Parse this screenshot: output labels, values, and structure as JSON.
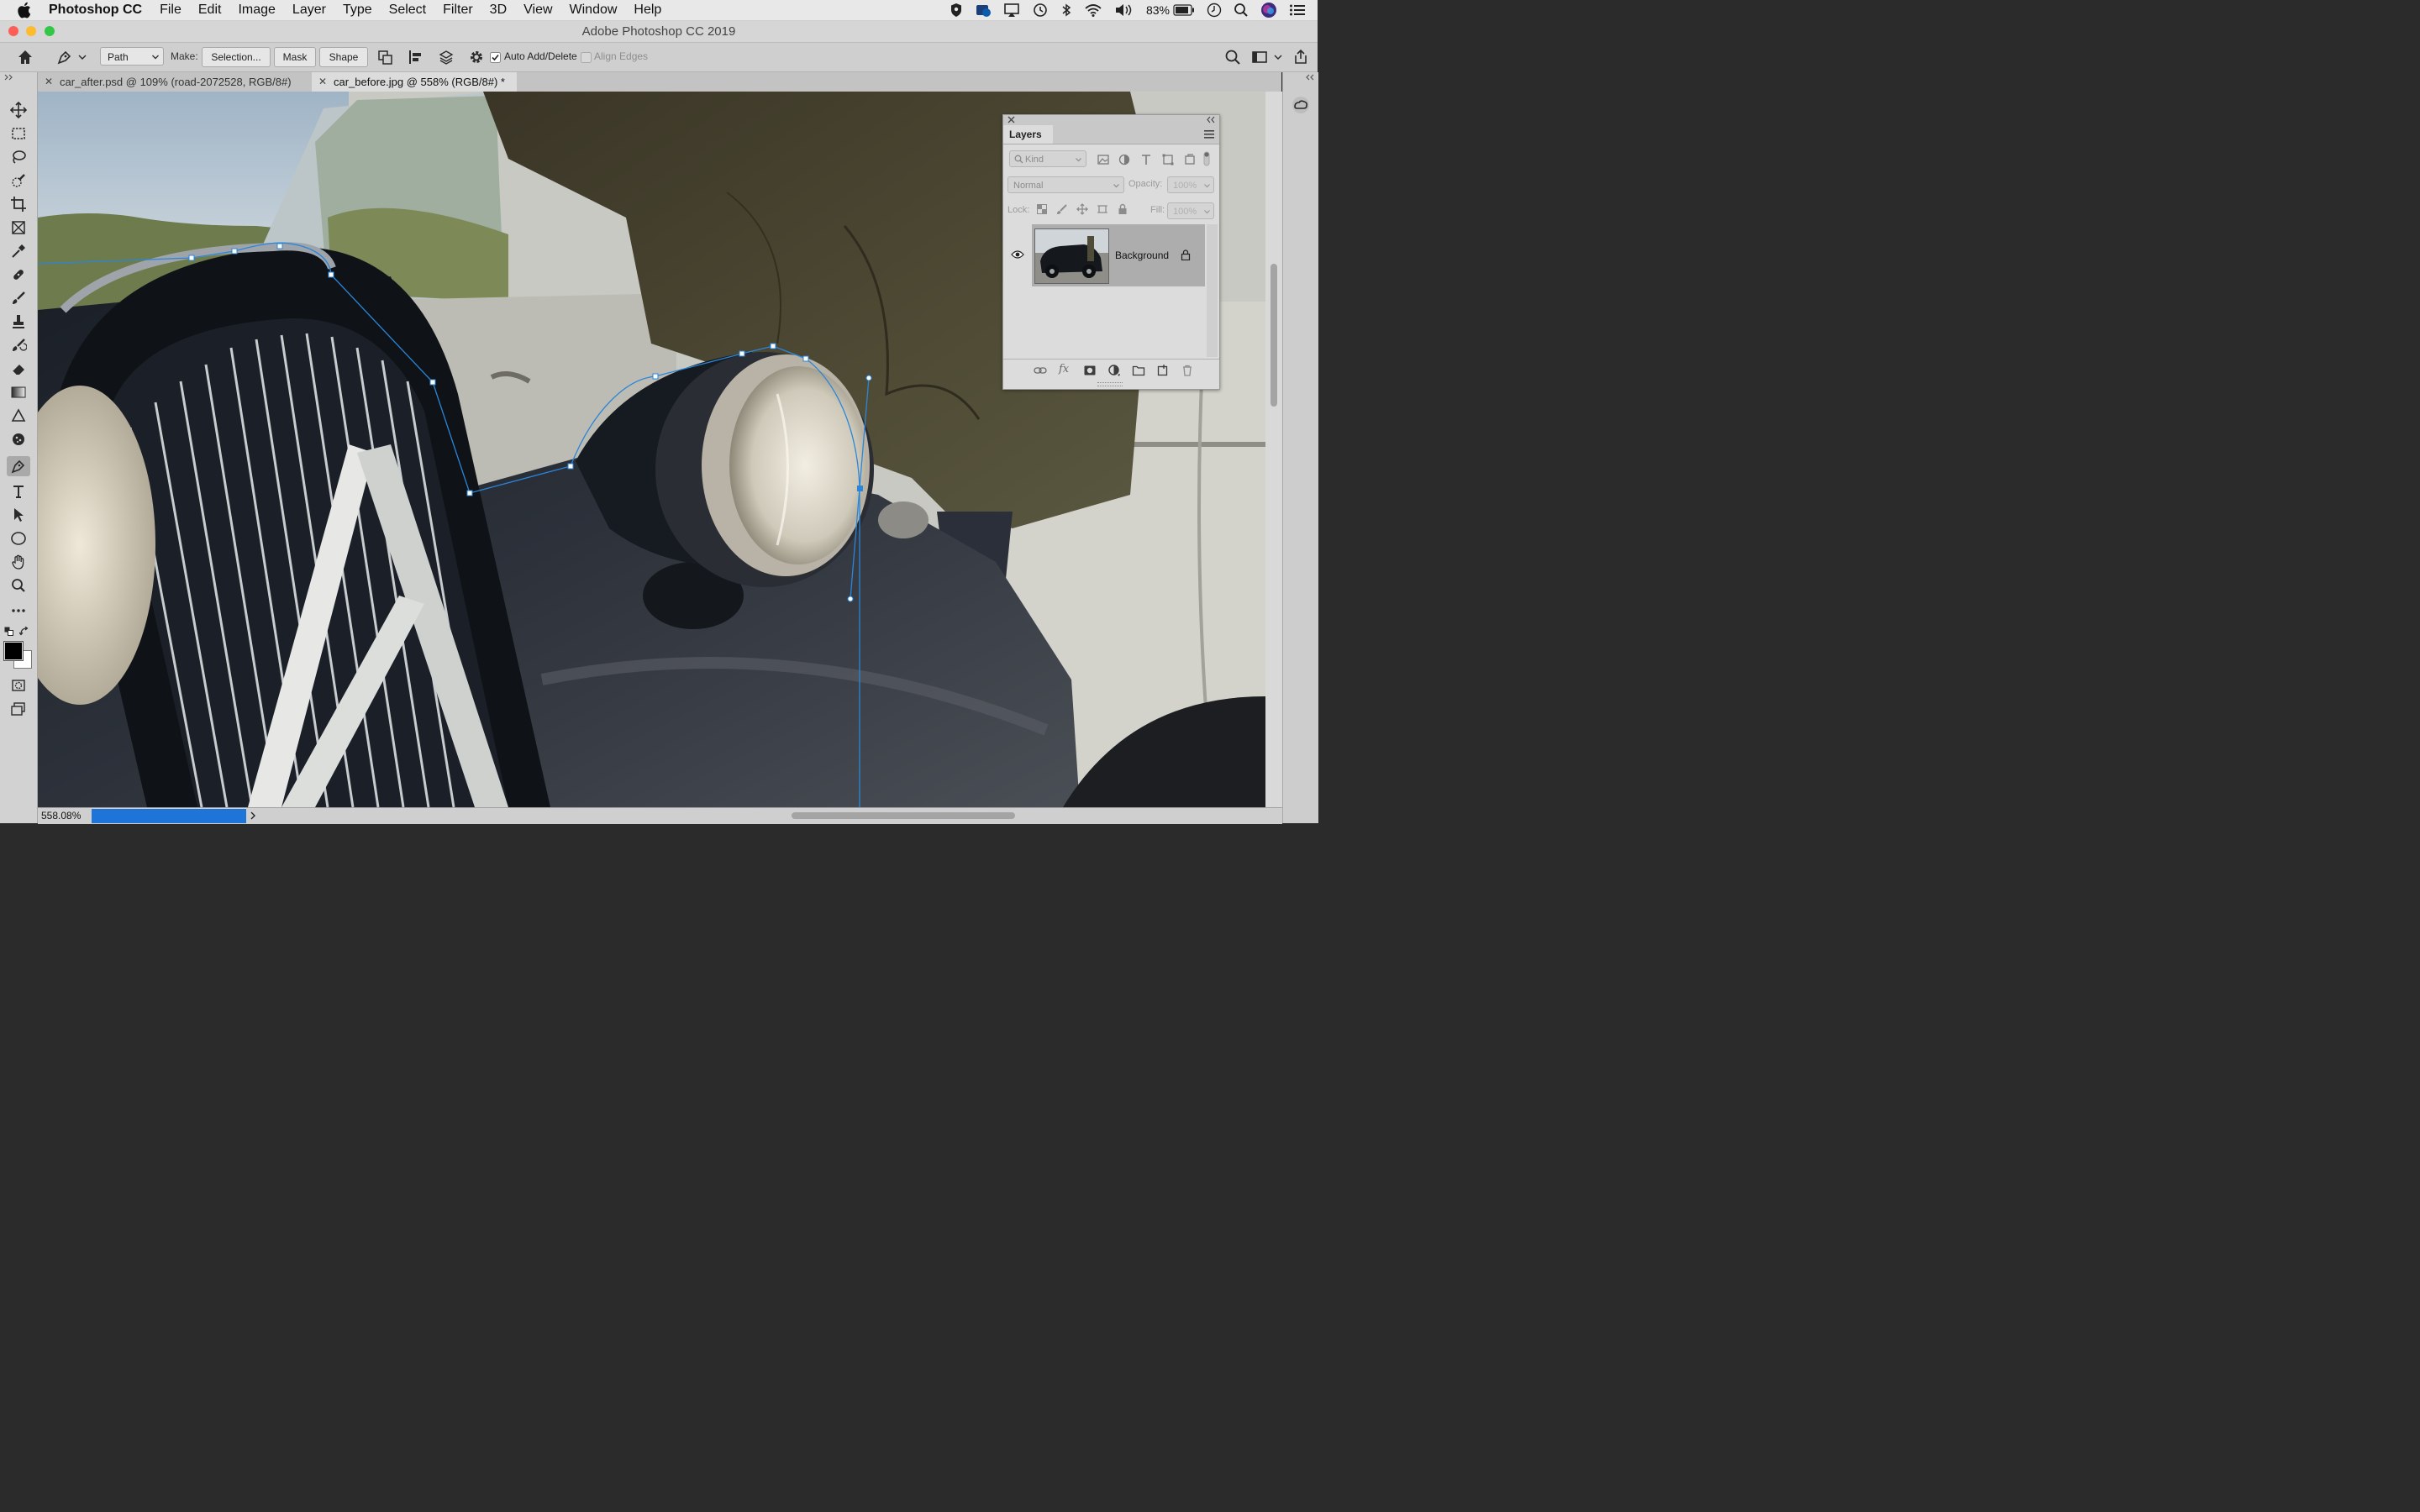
{
  "menubar": {
    "items": [
      "Photoshop CC",
      "File",
      "Edit",
      "Image",
      "Layer",
      "Type",
      "Select",
      "Filter",
      "3D",
      "View",
      "Window",
      "Help"
    ],
    "battery_percent": "83%",
    "status_icons": [
      "shield-icon",
      "cloud-icon",
      "airplay-icon",
      "time-machine-icon",
      "bluetooth-icon",
      "wifi-icon",
      "volume-icon",
      "battery-icon",
      "clock-icon",
      "spotlight-icon",
      "siri-icon",
      "notification-center-icon"
    ]
  },
  "window": {
    "title": "Adobe Photoshop CC 2019"
  },
  "options": {
    "path_mode": "Path",
    "make_label": "Make:",
    "selection_button": "Selection...",
    "mask_button": "Mask",
    "shape_button": "Shape",
    "auto_add_delete": "Auto Add/Delete",
    "auto_add_delete_checked": true,
    "align_edges": "Align Edges",
    "align_edges_checked": false
  },
  "tabs": [
    {
      "label": "car_after.psd @ 109% (road-2072528, RGB/8#)",
      "active": false
    },
    {
      "label": "car_before.jpg @ 558% (RGB/8#) *",
      "active": true
    }
  ],
  "tools": [
    "move-tool",
    "marquee-tool",
    "lasso-tool",
    "quick-selection-tool",
    "crop-tool",
    "frame-tool",
    "eyedropper-tool",
    "healing-brush-tool",
    "brush-tool",
    "clone-stamp-tool",
    "history-brush-tool",
    "eraser-tool",
    "gradient-tool",
    "blur-tool",
    "dodge-tool",
    "pen-tool",
    "type-tool",
    "path-selection-tool",
    "ellipse-tool",
    "hand-tool",
    "zoom-tool",
    "more-tools"
  ],
  "selected_tool": "pen-tool",
  "colors": {
    "foreground": "#000000",
    "background": "#ffffff",
    "accent": "#1f74d8",
    "path": "#2a86d8"
  },
  "layers_panel": {
    "title": "Layers",
    "filter_kind": "Kind",
    "blend_mode": "Normal",
    "opacity_label": "Opacity:",
    "opacity_value": "100%",
    "lock_label": "Lock:",
    "fill_label": "Fill:",
    "fill_value": "100%",
    "layers": [
      {
        "name": "Background",
        "visible": true,
        "locked": true
      }
    ]
  },
  "status": {
    "zoom": "558.08%",
    "progress_fraction": 1.0
  }
}
